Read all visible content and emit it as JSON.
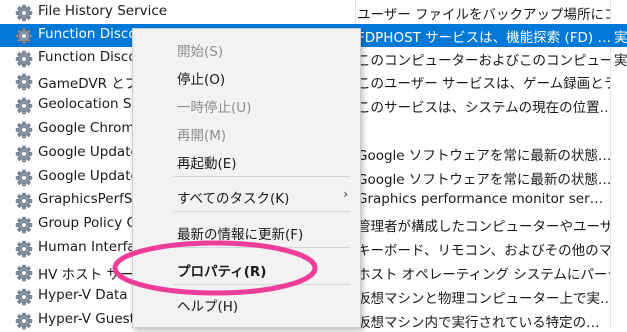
{
  "services": [
    {
      "name": "File History Service",
      "description": "ユーザー ファイルをバックアップ場所にコピ…",
      "status": ""
    },
    {
      "name": "Function Discovery Provider Host",
      "description": "FDPHOST サービスは、機能探索 (FD) …",
      "status": "実"
    },
    {
      "name": "Function Discovery Resource Publication",
      "description": "このコンピューターおよびこのコンピューター…",
      "status": "実"
    },
    {
      "name": "GameDVR とブロードキャスト",
      "description": "このユーザー サービスは、ゲーム録画とライ…",
      "status": ""
    },
    {
      "name": "Geolocation Service",
      "description": "このサービスは、システムの現在の位置…",
      "status": ""
    },
    {
      "name": "Google Chrome",
      "description": "",
      "status": ""
    },
    {
      "name": "Google Update Service (gupdate)",
      "description": "Google ソフトウェアを常に最新の状態…",
      "status": ""
    },
    {
      "name": "Google Update Service (gupdatem)",
      "description": "Google ソフトウェアを常に最新の状態…",
      "status": ""
    },
    {
      "name": "GraphicsPerfSvc",
      "description": "Graphics performance monitor ser…",
      "status": ""
    },
    {
      "name": "Group Policy Client",
      "description": "管理者が構成したコンピューターやユーザ…",
      "status": ""
    },
    {
      "name": "Human Interface Device Service",
      "description": "キーボード、リモコン、およびその他のマル…",
      "status": ""
    },
    {
      "name": "HV ホスト サービス",
      "description": "ホスト オペレーティング システムにパーティ…",
      "status": ""
    },
    {
      "name": "Hyper-V Data Exchange Service",
      "description": "仮想マシンと物理コンピューター上で実…",
      "status": ""
    },
    {
      "name": "Hyper-V Guest Service Interface",
      "description": "仮想マシン内で実行されている特定の…",
      "status": ""
    }
  ],
  "context_menu": {
    "start": "開始(S)",
    "stop": "停止(O)",
    "pause": "一時停止(U)",
    "resume": "再開(M)",
    "restart": "再起動(E)",
    "all_tasks": "すべてのタスク(K)",
    "refresh": "最新の情報に更新(F)",
    "properties": "プロパティ(R)",
    "help": "ヘルプ(H)",
    "submenu_arrow": "›"
  },
  "colors": {
    "selection": "#0078d7",
    "highlight_annotation": "#ee3d96",
    "menu_background": "#f2f2f2"
  },
  "icons": {
    "service": "gear-icon"
  }
}
